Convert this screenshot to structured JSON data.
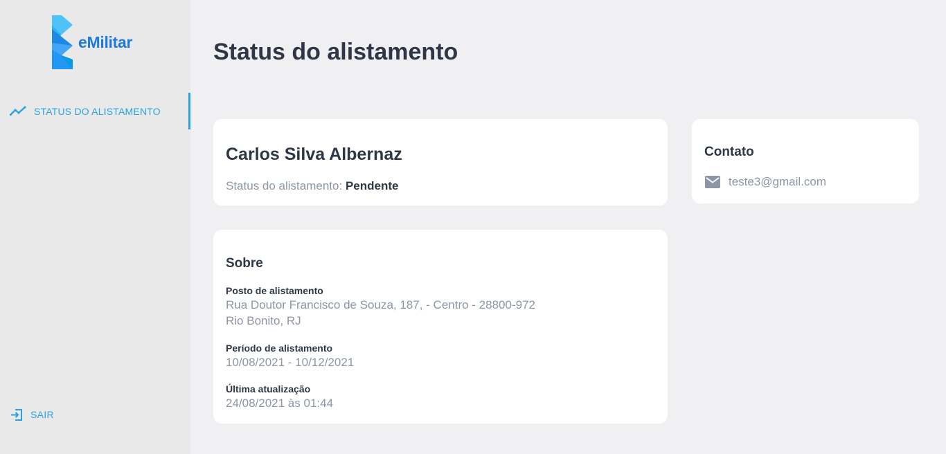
{
  "app": {
    "logo_text": "eMilitar"
  },
  "colors": {
    "accent": "#2aa2dd",
    "brand": "#1f7bd8",
    "text_dark": "#2f3747",
    "text_muted": "#8d96a5",
    "sidebar_bg": "#e9e9ea",
    "page_bg": "#f0f0f2",
    "card_bg": "#ffffff"
  },
  "sidebar": {
    "items": [
      {
        "label": "STATUS DO ALISTAMENTO",
        "icon": "trending-up-icon",
        "active": true
      }
    ],
    "logout": {
      "label": "SAIR",
      "icon": "logout-icon"
    }
  },
  "main": {
    "title": "Status do alistamento",
    "profile": {
      "name": "Carlos Silva Albernaz",
      "status_label": "Status do alistamento: ",
      "status_value": "Pendente"
    },
    "contact": {
      "title": "Contato",
      "email_icon": "mail-icon",
      "email": "teste3@gmail.com"
    },
    "about": {
      "title": "Sobre",
      "posto_label": "Posto de alistamento",
      "posto_line1": "Rua Doutor Francisco de Souza, 187,  - Centro - 28800-972",
      "posto_line2": "Rio Bonito, RJ",
      "periodo_label": "Período de alistamento",
      "periodo_value": "10/08/2021 - 10/12/2021",
      "atualizacao_label": "Última atualização",
      "atualizacao_value": "24/08/2021 às 01:44"
    }
  }
}
